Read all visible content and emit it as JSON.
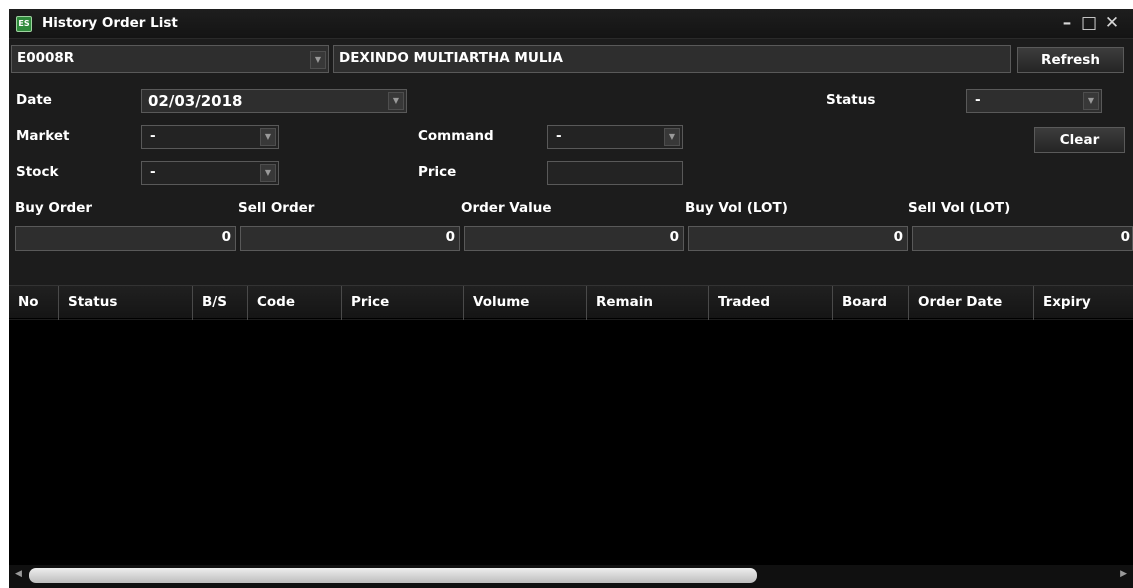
{
  "window": {
    "title": "History Order List",
    "app_icon_text": "ES",
    "controls": {
      "minimize": "–",
      "maximize": "□",
      "close": "✕"
    }
  },
  "account": {
    "code": "E0008R",
    "name": "DEXINDO MULTIARTHA MULIA"
  },
  "buttons": {
    "refresh": "Refresh",
    "clear": "Clear"
  },
  "filters": {
    "date_label": "Date",
    "date_value": "02/03/2018",
    "status_label": "Status",
    "status_value": "-",
    "market_label": "Market",
    "market_value": "-",
    "command_label": "Command",
    "command_value": "-",
    "stock_label": "Stock",
    "stock_value": "-",
    "price_label": "Price",
    "price_value": ""
  },
  "summary": {
    "buy_order_label": "Buy Order",
    "buy_order_value": "0",
    "sell_order_label": "Sell Order",
    "sell_order_value": "0",
    "order_value_label": "Order Value",
    "order_value_value": "0",
    "buy_vol_label": "Buy Vol (LOT)",
    "buy_vol_value": "0",
    "sell_vol_label": "Sell Vol (LOT)",
    "sell_vol_value": "0"
  },
  "table": {
    "columns": [
      "No",
      "Status",
      "B/S",
      "Code",
      "Price",
      "Volume",
      "Remain",
      "Traded",
      "Board",
      "Order Date",
      "Expiry"
    ],
    "rows": []
  },
  "icons": {
    "dropdown_arrow": "chevron-down-icon",
    "scroll_left": "◀",
    "scroll_right": "▶"
  },
  "colors": {
    "background": "#1c1c1c",
    "grid": "#000000",
    "text": "#ffffff",
    "icon_green": "#2f8a3c"
  }
}
